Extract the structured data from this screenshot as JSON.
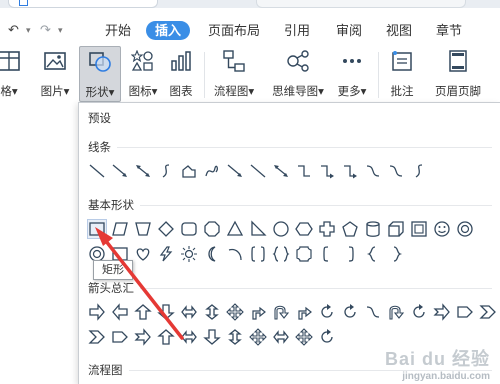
{
  "menubar": {
    "items": [
      "开始",
      "插入",
      "页面布局",
      "引用",
      "审阅",
      "视图",
      "章节"
    ],
    "active": "插入"
  },
  "ribbon": {
    "items": [
      {
        "label": "格▾",
        "icon": "table-icon"
      },
      {
        "label": "图片▾",
        "icon": "picture-icon"
      },
      {
        "label": "形状▾",
        "icon": "shapes-icon"
      },
      {
        "label": "图标▾",
        "icon": "icons-icon"
      },
      {
        "label": "图表",
        "icon": "chart-icon"
      },
      {
        "label": "流程图▾",
        "icon": "flowchart-icon"
      },
      {
        "label": "思维导图▾",
        "icon": "mindmap-icon"
      },
      {
        "label": "更多▾",
        "icon": "more-icon"
      },
      {
        "label": "批注",
        "icon": "comment-icon"
      },
      {
        "label": "页眉页脚",
        "icon": "header-footer-icon"
      }
    ]
  },
  "panel": {
    "title": "预设",
    "sections": {
      "lines": "线条",
      "basic": "基本形状",
      "arrows": "箭头总汇",
      "flow": "流程图"
    },
    "tooltip": "矩形"
  },
  "watermark": {
    "brand": "Bai du 经验",
    "url": "jingyan.baidu.com"
  },
  "colors": {
    "accent": "#3a8ee6",
    "icon_stroke": "#34495e",
    "annotation_arrow": "#e53935"
  }
}
